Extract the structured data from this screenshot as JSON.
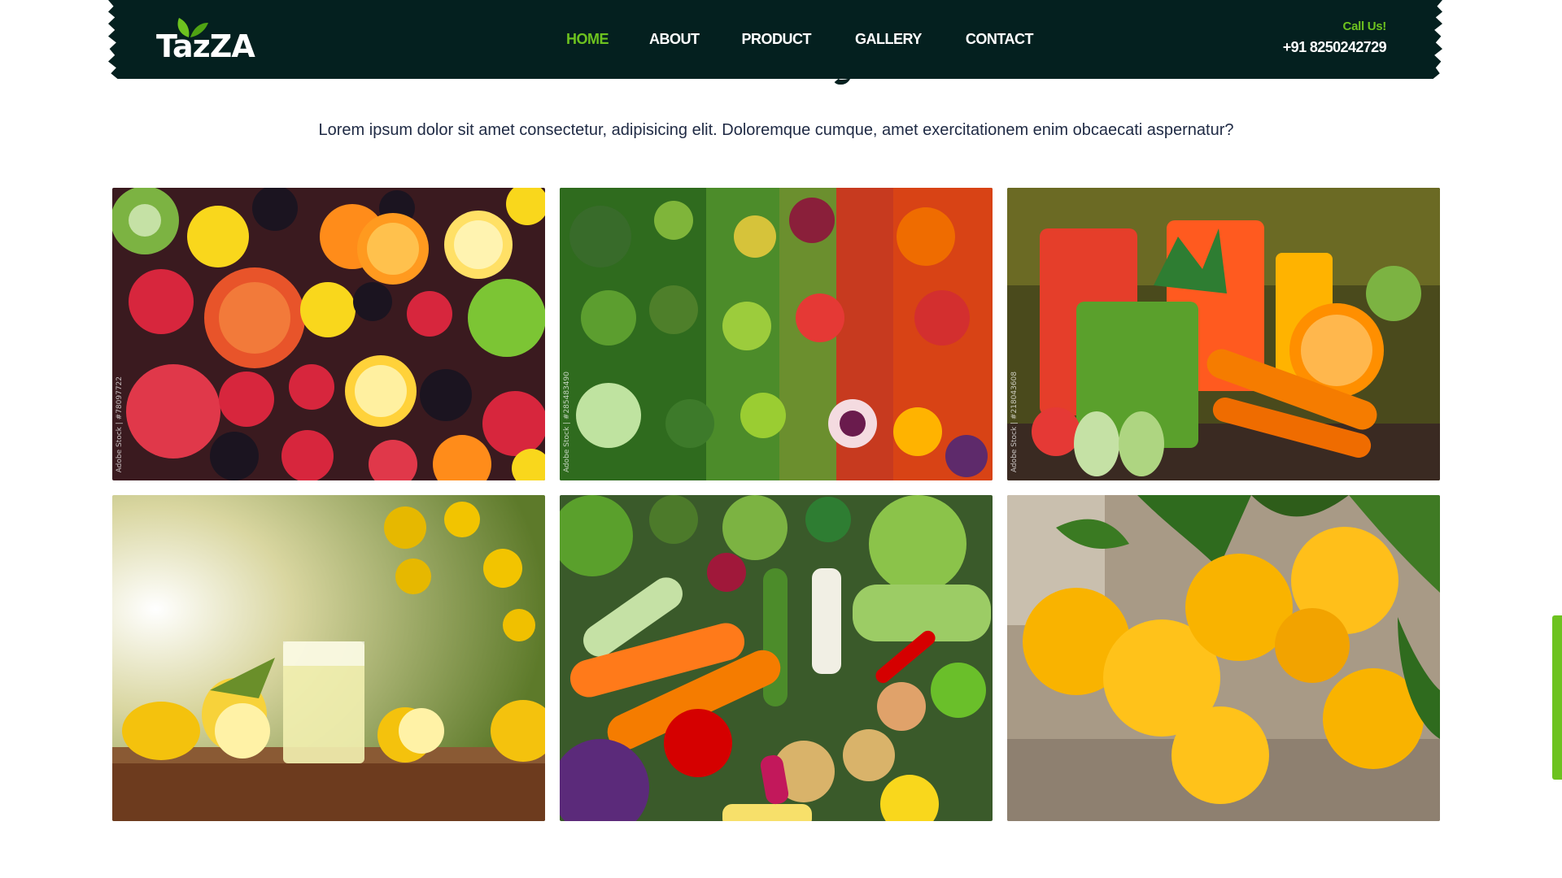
{
  "header": {
    "logo": "TazZA",
    "nav": [
      {
        "label": "HOME",
        "active": true
      },
      {
        "label": "ABOUT",
        "active": false
      },
      {
        "label": "PRODUCT",
        "active": false
      },
      {
        "label": "GALLERY",
        "active": false
      },
      {
        "label": "CONTACT",
        "active": false
      }
    ],
    "call_label": "Call Us!",
    "call_number": "+91 8250242729"
  },
  "intro": "Lorem ipsum dolor sit amet consectetur, adipisicing elit. Doloremque cumque, amet exercitationem enim obcaecati aspernatur?",
  "gallery": [
    {
      "name": "fruit-mix",
      "watermark": "Adobe Stock | #78097722"
    },
    {
      "name": "vegetable-colors",
      "watermark": "Adobe Stock | #285483490"
    },
    {
      "name": "juices-with-produce",
      "watermark": "Adobe Stock | #218043608"
    },
    {
      "name": "lemon-juice-orchard",
      "watermark": ""
    },
    {
      "name": "fresh-vegetables",
      "watermark": ""
    },
    {
      "name": "oranges-on-tree",
      "watermark": ""
    }
  ],
  "colors": {
    "header_bg": "#04201f",
    "accent_green": "#6dc21f",
    "text_dark": "#1f2a44"
  }
}
